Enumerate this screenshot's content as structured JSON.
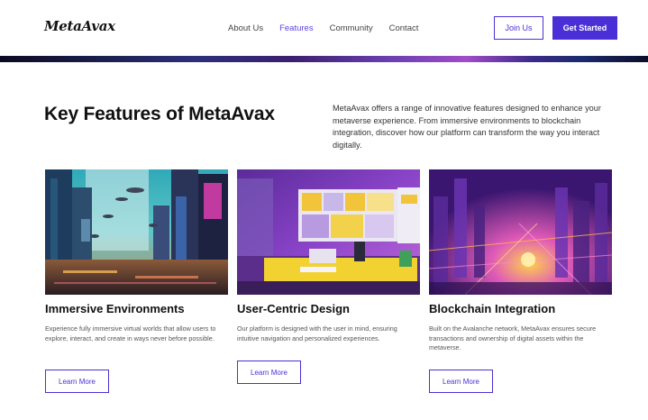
{
  "nav": {
    "logo": "MetaAvax",
    "links": [
      "About Us",
      "Features",
      "Community",
      "Contact"
    ],
    "active_link": "Features",
    "join_label": "Join Us",
    "cta_label": "Get Started"
  },
  "section": {
    "title": "Key Features of MetaAvax",
    "intro": "MetaAvax offers a range of innovative features designed to enhance your metaverse experience. From immersive environments to blockchain integration, discover how our platform can transform the way you interact digitally."
  },
  "cards": [
    {
      "title": "Immersive Environments",
      "body": "Experience fully immersive virtual worlds that allow users to explore, interact, and create in ways never before possible.",
      "button": "Learn More"
    },
    {
      "title": "User-Centric Design",
      "body": "Our platform is designed with the user in mind, ensuring intuitive navigation and personalized experiences.",
      "button": "Learn More"
    },
    {
      "title": "Blockchain Integration",
      "body": "Built on the Avalanche network, MetaAvax ensures secure transactions and ownership of digital assets within the metaverse.",
      "button": "Learn More"
    }
  ],
  "colors": {
    "accent": "#4b2fd6"
  }
}
